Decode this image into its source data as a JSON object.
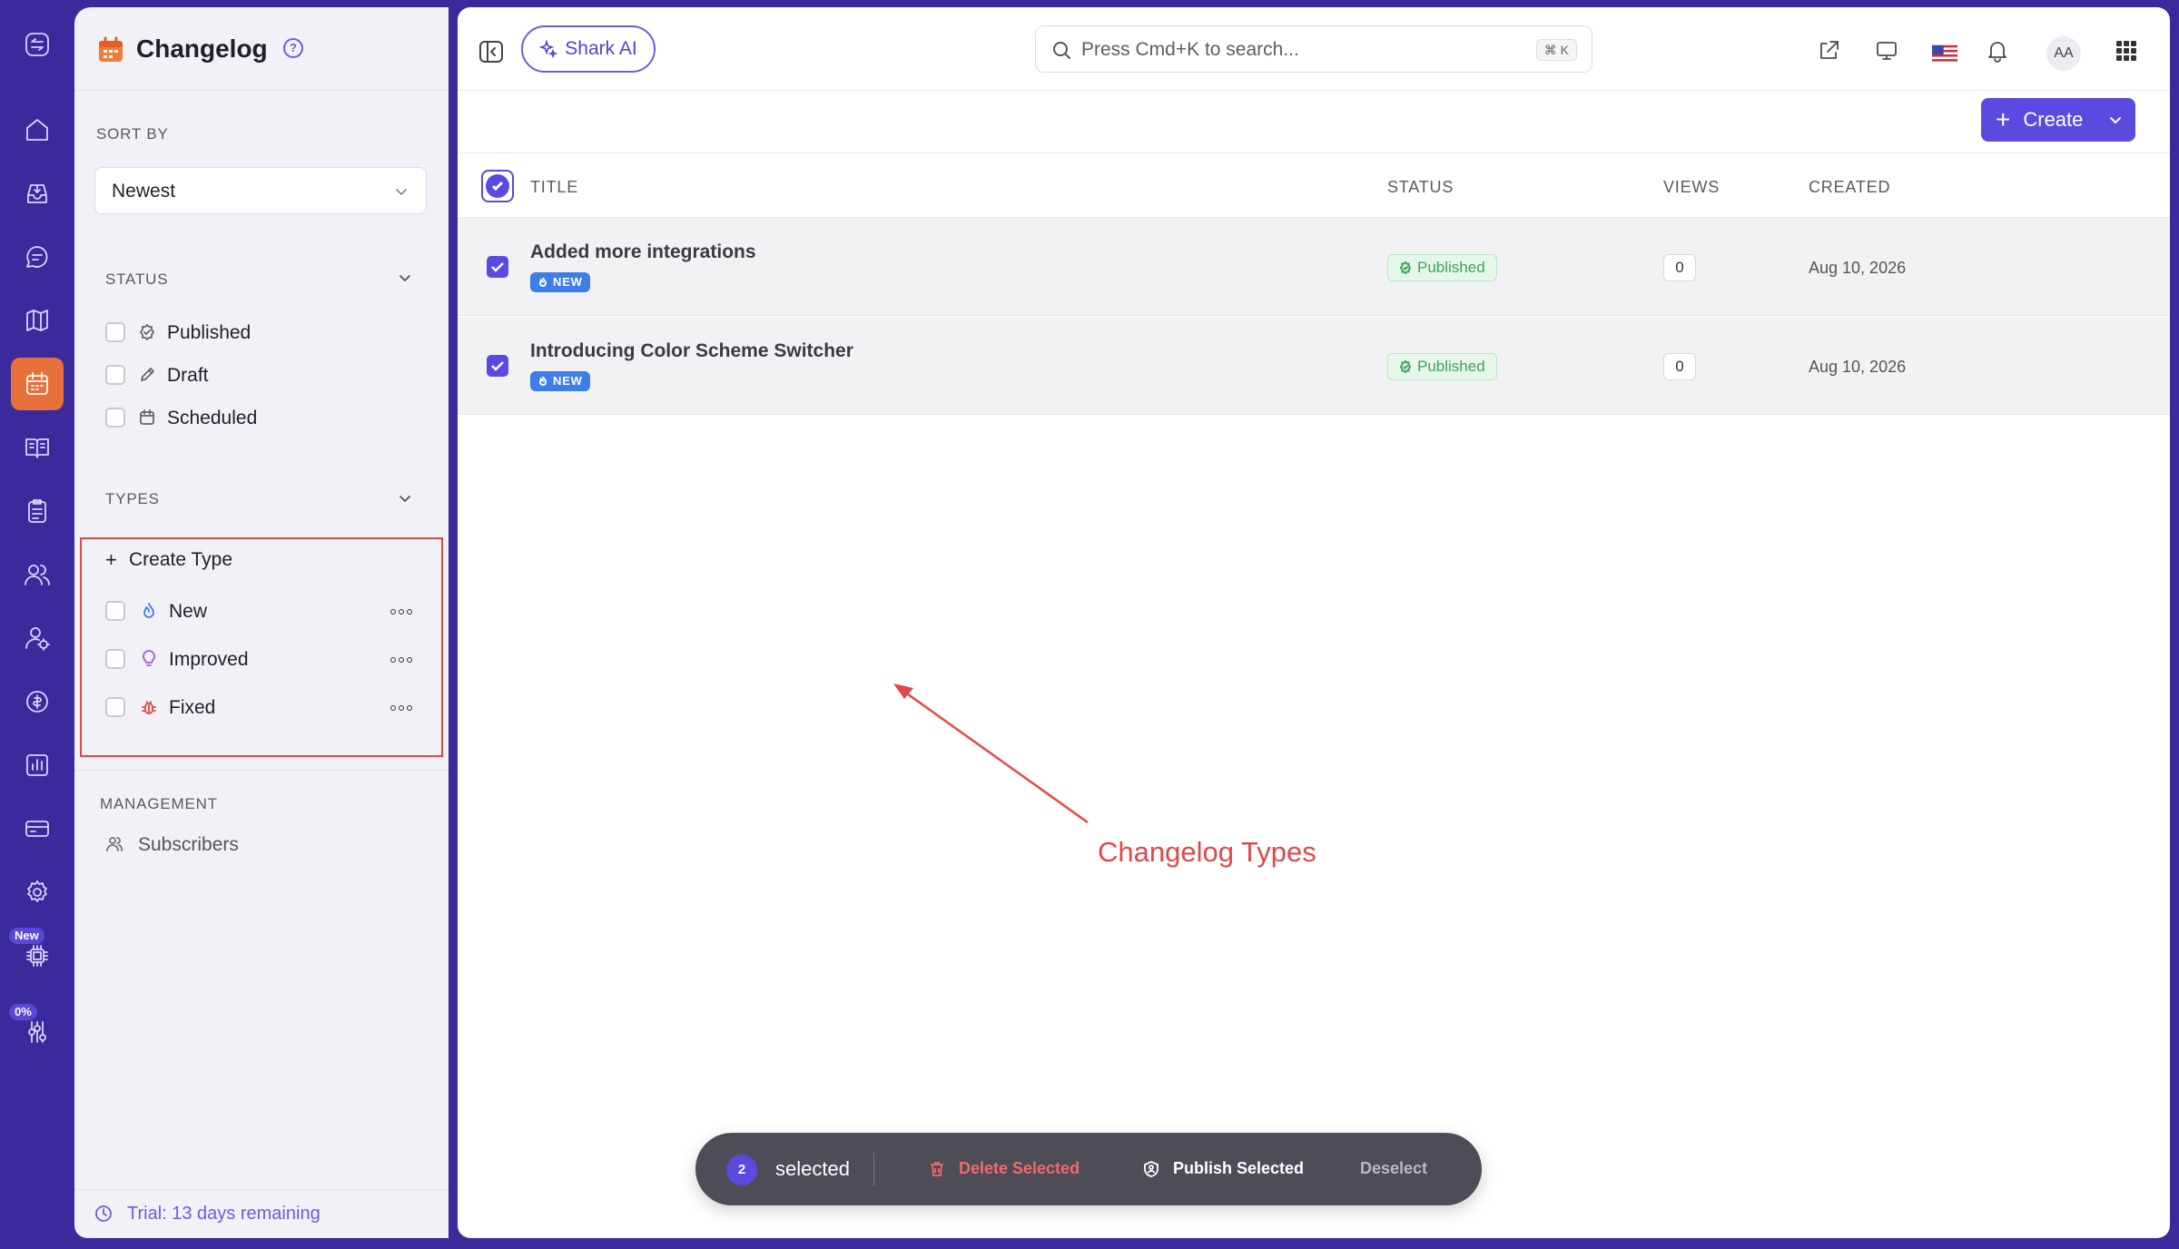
{
  "app": {
    "page_title": "Changelog",
    "help_glyph": "?"
  },
  "rail": {
    "items": [
      {
        "icon": "home-icon"
      },
      {
        "icon": "inbox-icon"
      },
      {
        "icon": "chat-icon"
      },
      {
        "icon": "map-icon"
      },
      {
        "icon": "calendar-icon",
        "active": true
      },
      {
        "icon": "book-icon"
      },
      {
        "icon": "clipboard-icon"
      },
      {
        "icon": "users-icon"
      },
      {
        "icon": "user-settings-icon"
      },
      {
        "icon": "coin-icon"
      },
      {
        "icon": "bar-chart-icon"
      },
      {
        "icon": "credit-card-icon"
      },
      {
        "icon": "gear-icon"
      },
      {
        "icon": "chip-icon",
        "badge": "New"
      },
      {
        "icon": "sliders-icon",
        "badge": "0%"
      }
    ]
  },
  "sidebar": {
    "sort_by_label": "SORT BY",
    "sort_value": "Newest",
    "status_label": "STATUS",
    "status_items": [
      {
        "label": "Published",
        "icon": "badge-check-icon"
      },
      {
        "label": "Draft",
        "icon": "pencil-icon"
      },
      {
        "label": "Scheduled",
        "icon": "calendar-small-icon"
      }
    ],
    "types_label": "TYPES",
    "create_type_label": "Create Type",
    "create_type_glyph": "+",
    "type_items": [
      {
        "label": "New",
        "icon": "flame-icon",
        "color": "#3d7ee8"
      },
      {
        "label": "Improved",
        "icon": "lightbulb-icon",
        "color": "#a25bd6"
      },
      {
        "label": "Fixed",
        "icon": "bug-icon",
        "color": "#e04848"
      }
    ],
    "management_label": "MANAGEMENT",
    "subscribers_label": "Subscribers",
    "trial_text": "Trial: 13 days remaining"
  },
  "topbar": {
    "shark_ai_label": "Shark AI",
    "search_placeholder": "Press Cmd+K to search...",
    "search_shortcut": "⌘ K",
    "avatar_initials": "AA"
  },
  "toolbar": {
    "create_label": "Create",
    "create_glyph": "+"
  },
  "table": {
    "columns": [
      "TITLE",
      "STATUS",
      "VIEWS",
      "CREATED"
    ],
    "rows": [
      {
        "title": "Added more integrations",
        "tag": "NEW",
        "status": "Published",
        "views": "0",
        "created": "Aug 10, 2026"
      },
      {
        "title": "Introducing Color Scheme Switcher",
        "tag": "NEW",
        "status": "Published",
        "views": "0",
        "created": "Aug 10, 2026"
      }
    ]
  },
  "annotation": {
    "text": "Changelog Types",
    "color": "#e04848"
  },
  "selection_bar": {
    "count": "2",
    "selected_label": "selected",
    "delete_label": "Delete Selected",
    "publish_label": "Publish Selected",
    "deselect_label": "Deselect"
  },
  "colors": {
    "accent": "#5b4ae0",
    "rail_bg": "#3b2a9c",
    "active_rail": "#e8703a",
    "published": "#3aa55c"
  }
}
